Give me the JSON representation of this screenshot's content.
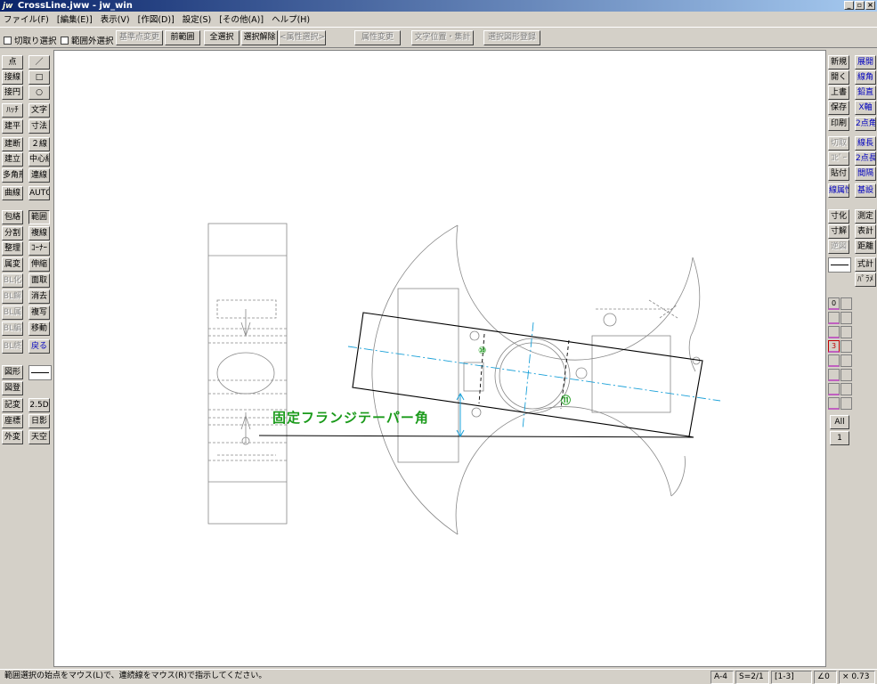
{
  "window": {
    "app_icon": "jw",
    "title": "CrossLine.jww - jw_win",
    "controls": [
      "_",
      "▫",
      "×"
    ]
  },
  "menu": [
    "ファイル(F)",
    "[編集(E)]",
    "表示(V)",
    "[作図(D)]",
    "設定(S)",
    "[その他(A)]",
    "ヘルプ(H)"
  ],
  "toolbar": {
    "check_cut": "切取り選択",
    "check_outside": "範囲外選択",
    "btn_base_point": "基準点変更",
    "btn_prev_range": "前範囲",
    "btn_select_all": "全選択",
    "btn_deselect": "選択解除",
    "btn_attr_select": "<属性選択>",
    "btn_attr_change": "属性変更",
    "btn_text_pos": "文字位置・集計",
    "btn_register": "選択図形登録"
  },
  "left_tools": [
    [
      "点",
      "／"
    ],
    [
      "接線",
      "□"
    ],
    [
      "接円",
      "○"
    ],
    [
      "ﾊｯﾁ",
      "文字"
    ],
    [
      "建平",
      "寸法"
    ],
    [
      "建断",
      "２線"
    ],
    [
      "建立",
      "中心線"
    ],
    [
      "多角形",
      "連線"
    ],
    [
      "曲線",
      "AUTO"
    ],
    [
      "包絡",
      "範囲"
    ],
    [
      "分割",
      "複線"
    ],
    [
      "整理",
      "ｺｰﾅｰ"
    ],
    [
      "属変",
      "伸縮"
    ],
    [
      "BL化",
      "面取"
    ],
    [
      "BL解",
      "消去"
    ],
    [
      "BL属",
      "複写"
    ],
    [
      "BL編",
      "移動"
    ],
    [
      "BL終",
      "戻る"
    ],
    [
      "図形",
      ""
    ],
    [
      "図登",
      ""
    ],
    [
      "記変",
      "2.5D"
    ],
    [
      "座標",
      "日影"
    ],
    [
      "外変",
      "天空"
    ]
  ],
  "right_tools": [
    [
      "新規",
      "展開"
    ],
    [
      "開く",
      "線角"
    ],
    [
      "上書",
      "鉛直"
    ],
    [
      "保存",
      "X軸"
    ],
    [
      "印刷",
      "2点角"
    ],
    [
      "切取",
      "線長"
    ],
    [
      "ｺﾋﾟｰ",
      "2点長"
    ],
    [
      "貼付",
      "間隔"
    ],
    [
      "線属性",
      "基設"
    ],
    [
      "寸化",
      "測定"
    ],
    [
      "寸解",
      "表計"
    ],
    [
      "逆図",
      "距離"
    ],
    [
      "",
      "式計"
    ],
    [
      "",
      "ﾊﾟﾗﾒ"
    ]
  ],
  "layers": {
    "labels": [
      "0",
      "",
      "",
      "3",
      "",
      "",
      "",
      ""
    ],
    "all_label": "All",
    "group_label": "1"
  },
  "drawing": {
    "annotation": "固定フランジテーパー角",
    "marker_10": "⑩",
    "marker_11": "⑪"
  },
  "status": {
    "message": "範囲選択の始点をマウス(L)で、連続線をマウス(R)で指示してください。",
    "paper": "A-4",
    "scale": "S=2/1",
    "layer_group": "[1-3]",
    "angle": "∠0",
    "zoom": "× 0.73"
  },
  "colors": {
    "title_start": "#0a246a",
    "title_end": "#a6caf0",
    "annotation": "#1a9a1a",
    "centerline": "#19a0d8",
    "face": "#d4d0c8"
  }
}
